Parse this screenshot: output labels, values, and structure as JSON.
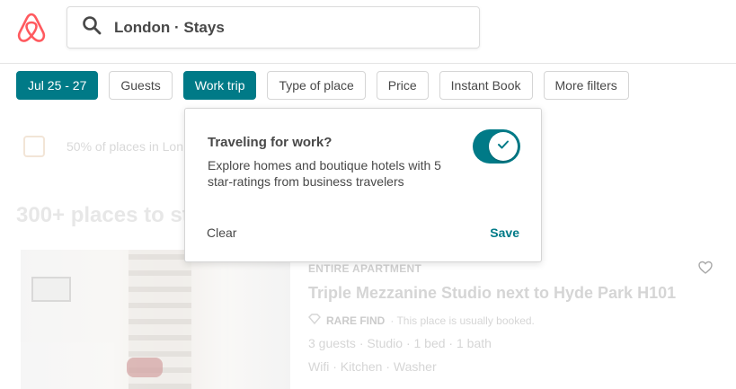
{
  "colors": {
    "brand": "#ff5a5f",
    "accent": "#007a87",
    "text": "#484848",
    "border": "#d5d5d5"
  },
  "header": {
    "logo_icon": "airbnb-logo-icon",
    "search": {
      "icon": "search-icon",
      "value": "London · Stays"
    }
  },
  "filters": [
    {
      "label": "Jul 25 - 27",
      "active": true
    },
    {
      "label": "Guests",
      "active": false
    },
    {
      "label": "Work trip",
      "active": true
    },
    {
      "label": "Type of place",
      "active": false
    },
    {
      "label": "Price",
      "active": false
    },
    {
      "label": "Instant Book",
      "active": false
    },
    {
      "label": "More filters",
      "active": false
    }
  ],
  "notice": {
    "icon": "calendar-icon",
    "text": "50% of places in Lon"
  },
  "results": {
    "count_label": "300+ places to st"
  },
  "listing": {
    "type": "ENTIRE APARTMENT",
    "title": "Triple Mezzanine Studio next to Hyde Park H101",
    "rare_find_label": "RARE FIND",
    "rare_find_note": "· This place is usually booked.",
    "details": "3 guests · Studio · 1 bed · 1 bath",
    "amenities": "Wifi · Kitchen · Washer",
    "favorite_icon": "heart-icon"
  },
  "popover": {
    "title": "Traveling for work?",
    "description": "Explore homes and boutique hotels with 5 star-ratings from business travelers",
    "toggle_on": true,
    "clear_label": "Clear",
    "save_label": "Save"
  }
}
